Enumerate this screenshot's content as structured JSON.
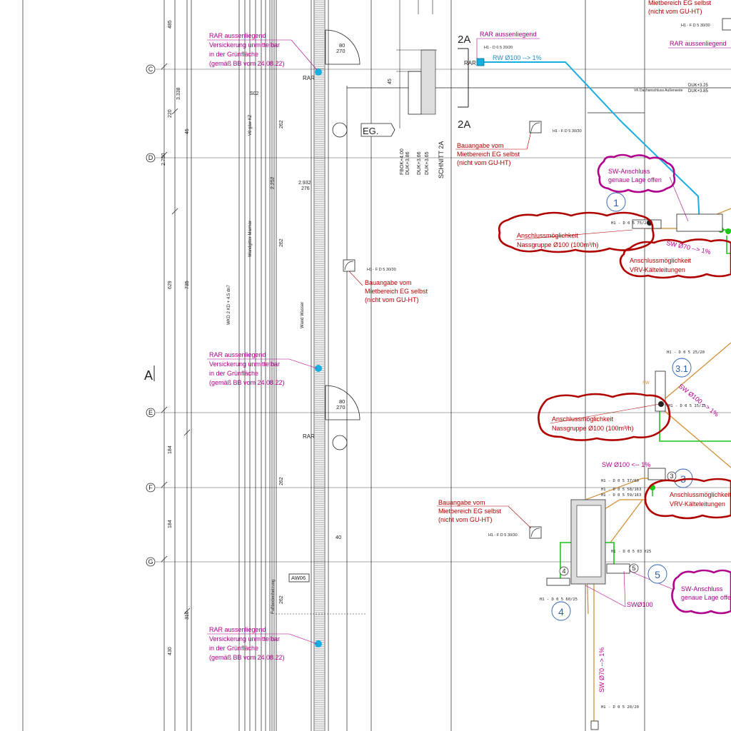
{
  "colors": {
    "magenta": "#b0008c",
    "red": "#b00000",
    "cyan": "#19aee0",
    "green": "#1cc41c",
    "orange": "#d08a2c",
    "blue": "#2a5fb0",
    "line": "#2a2a2a"
  },
  "axes": {
    "C": "C",
    "D": "D",
    "E": "E",
    "F": "F",
    "G": "G",
    "A": "A"
  },
  "section": {
    "label_2a_top": "2A",
    "label_2a_bottom": "2A",
    "schnitt": "SCHNITT 2A",
    "eg": "EG."
  },
  "rar_notes": [
    {
      "line1": "RAR aussenliegend",
      "line2": "Versickerung unmittelbar",
      "line3": "in der Grünfläche",
      "line4": "(gemäß BB vom 24.08.22)"
    },
    {
      "line1": "RAR aussenliegend",
      "line2": "Versickerung unmittelbar",
      "line3": "in der Grünfläche",
      "line4": "(gemäß BB vom 24.08.22)"
    },
    {
      "line1": "RAR aussenliegend",
      "line2": "Versickerung unmittelbar",
      "line3": "in der Grünfläche",
      "line4": "(gemäß BB vom 24.08.22)"
    }
  ],
  "rar_small": {
    "rar1": "RAR",
    "rar2": "RAR",
    "rar3": "RAR"
  },
  "rar_top": {
    "title": "RAR aussenliegend",
    "code": "H1 - D 0 5 20/20",
    "rar": "RAR",
    "pipe": "RW Ø100 --> 1%"
  },
  "rar_top_right": "RAR aussenliegend",
  "bauangabe": [
    {
      "l1": "Bauangabe vom",
      "l2": "Mietbereich EG selbst",
      "l3": "(nicht vom GU-HT)"
    },
    {
      "l1": "Bauangabe vom",
      "l2": "Mietbereich EG selbst",
      "l3": "(nicht vom GU-HT)"
    },
    {
      "l1": "Bauangabe vom",
      "l2": "Mietbereich EG selbst",
      "l3": "(nicht vom GU-HT)"
    }
  ],
  "bauangabe_top": {
    "l2": "Mietbereich EG selbst",
    "l3": "(nicht vom GU-HT)"
  },
  "fd_codes": {
    "c1": "H1 - F D 5 30/30",
    "c2": "H1 - F D 5 30/30",
    "c3": "H1 - F D 5 30/30",
    "c4": "H1 - F D 5 30/30"
  },
  "sw_anschluss": [
    {
      "l1": "SW-Anschluss",
      "l2": "genaue Lage offen"
    },
    {
      "l1": "SW-Anschluss",
      "l2": "genaue Lage offen"
    }
  ],
  "anschluss_nass": [
    {
      "l1": "Anschlussmöglichkeit",
      "l2": "Nassgruppe Ø100 (100m³/h)"
    },
    {
      "l1": "Anschlussmöglichkeit",
      "l2": "Nassgruppe Ø100 (100m³/h)"
    }
  ],
  "anschluss_vrv": [
    {
      "l1": "Anschlussmöglichkeit",
      "l2": "VRV-Kälteleitungen"
    },
    {
      "l1": "Anschlussmöglichkeit",
      "l2": "VRV-Kälteleitungen"
    }
  ],
  "circles": {
    "n1": "1",
    "n31": "3.1",
    "n3": "3",
    "n4": "4",
    "n5": "5"
  },
  "small_circles": {
    "s3": "3",
    "s4": "4",
    "s5": "5"
  },
  "pipes": {
    "sw70": "SW Ø70 --> 1%",
    "sw100_diag": "SW Ø100 --> 1%",
    "sw100_left": "SW Ø100 <-- 1%",
    "sw100": "SWØ100",
    "sw70_vertical": "SW Ø70 --> 1%",
    "sw": "SW"
  },
  "codes": {
    "d0575": "H1 - D 0 5 75/20",
    "d0525": "H1 - D 0 5 25/20",
    "d0515": "H1 - D 0 5 15/15",
    "d0537": "H1 - D 0 5 37/60",
    "d0558": "H1 - D 0 5 58/163",
    "d0559": "H1 - D 0 5 59/163",
    "d0503": "H1 - D 0 5 03 Y25",
    "d0560": "H1 - D 0 5 60/25",
    "d0520": "H1 - D 0 5 20/20"
  },
  "dims_left": {
    "d485": "485",
    "d338": "3.338",
    "d220": "220",
    "d2750": "2.750",
    "d629": "629",
    "d735": "735",
    "d184a": "184",
    "d184b": "184",
    "d310": "310",
    "d430": "430",
    "d45": "45"
  },
  "dims_mid": {
    "d262a": "262",
    "d2252": "2.252",
    "d262b": "262",
    "d2932": "2.932",
    "d276": "276",
    "d262c": "262",
    "d262d": "262"
  },
  "door_dims": {
    "a80": "80",
    "a270": "270",
    "b80": "80",
    "b270": "270",
    "c40": "40"
  },
  "aw06": "AW06",
  "duk": {
    "fbok": "FBOK+4.00",
    "duk1": "DUK+3.86",
    "duk2": "DUK+3.66",
    "duk3": "DUK+3.65",
    "r1": "DUK+3.25",
    "r2": "DUK+3.85"
  },
  "vk": "VK Dachanschluss Außenseite",
  "s02": "S02",
  "vert_texts": {
    "wand": "WKD 2 KD + 4.5 dn7",
    "v1": "V8 gäw KZ",
    "v2": "Wandgitter Marmor",
    "v3": "Wand Wasser",
    "v4": "Fußbodenheizung"
  }
}
